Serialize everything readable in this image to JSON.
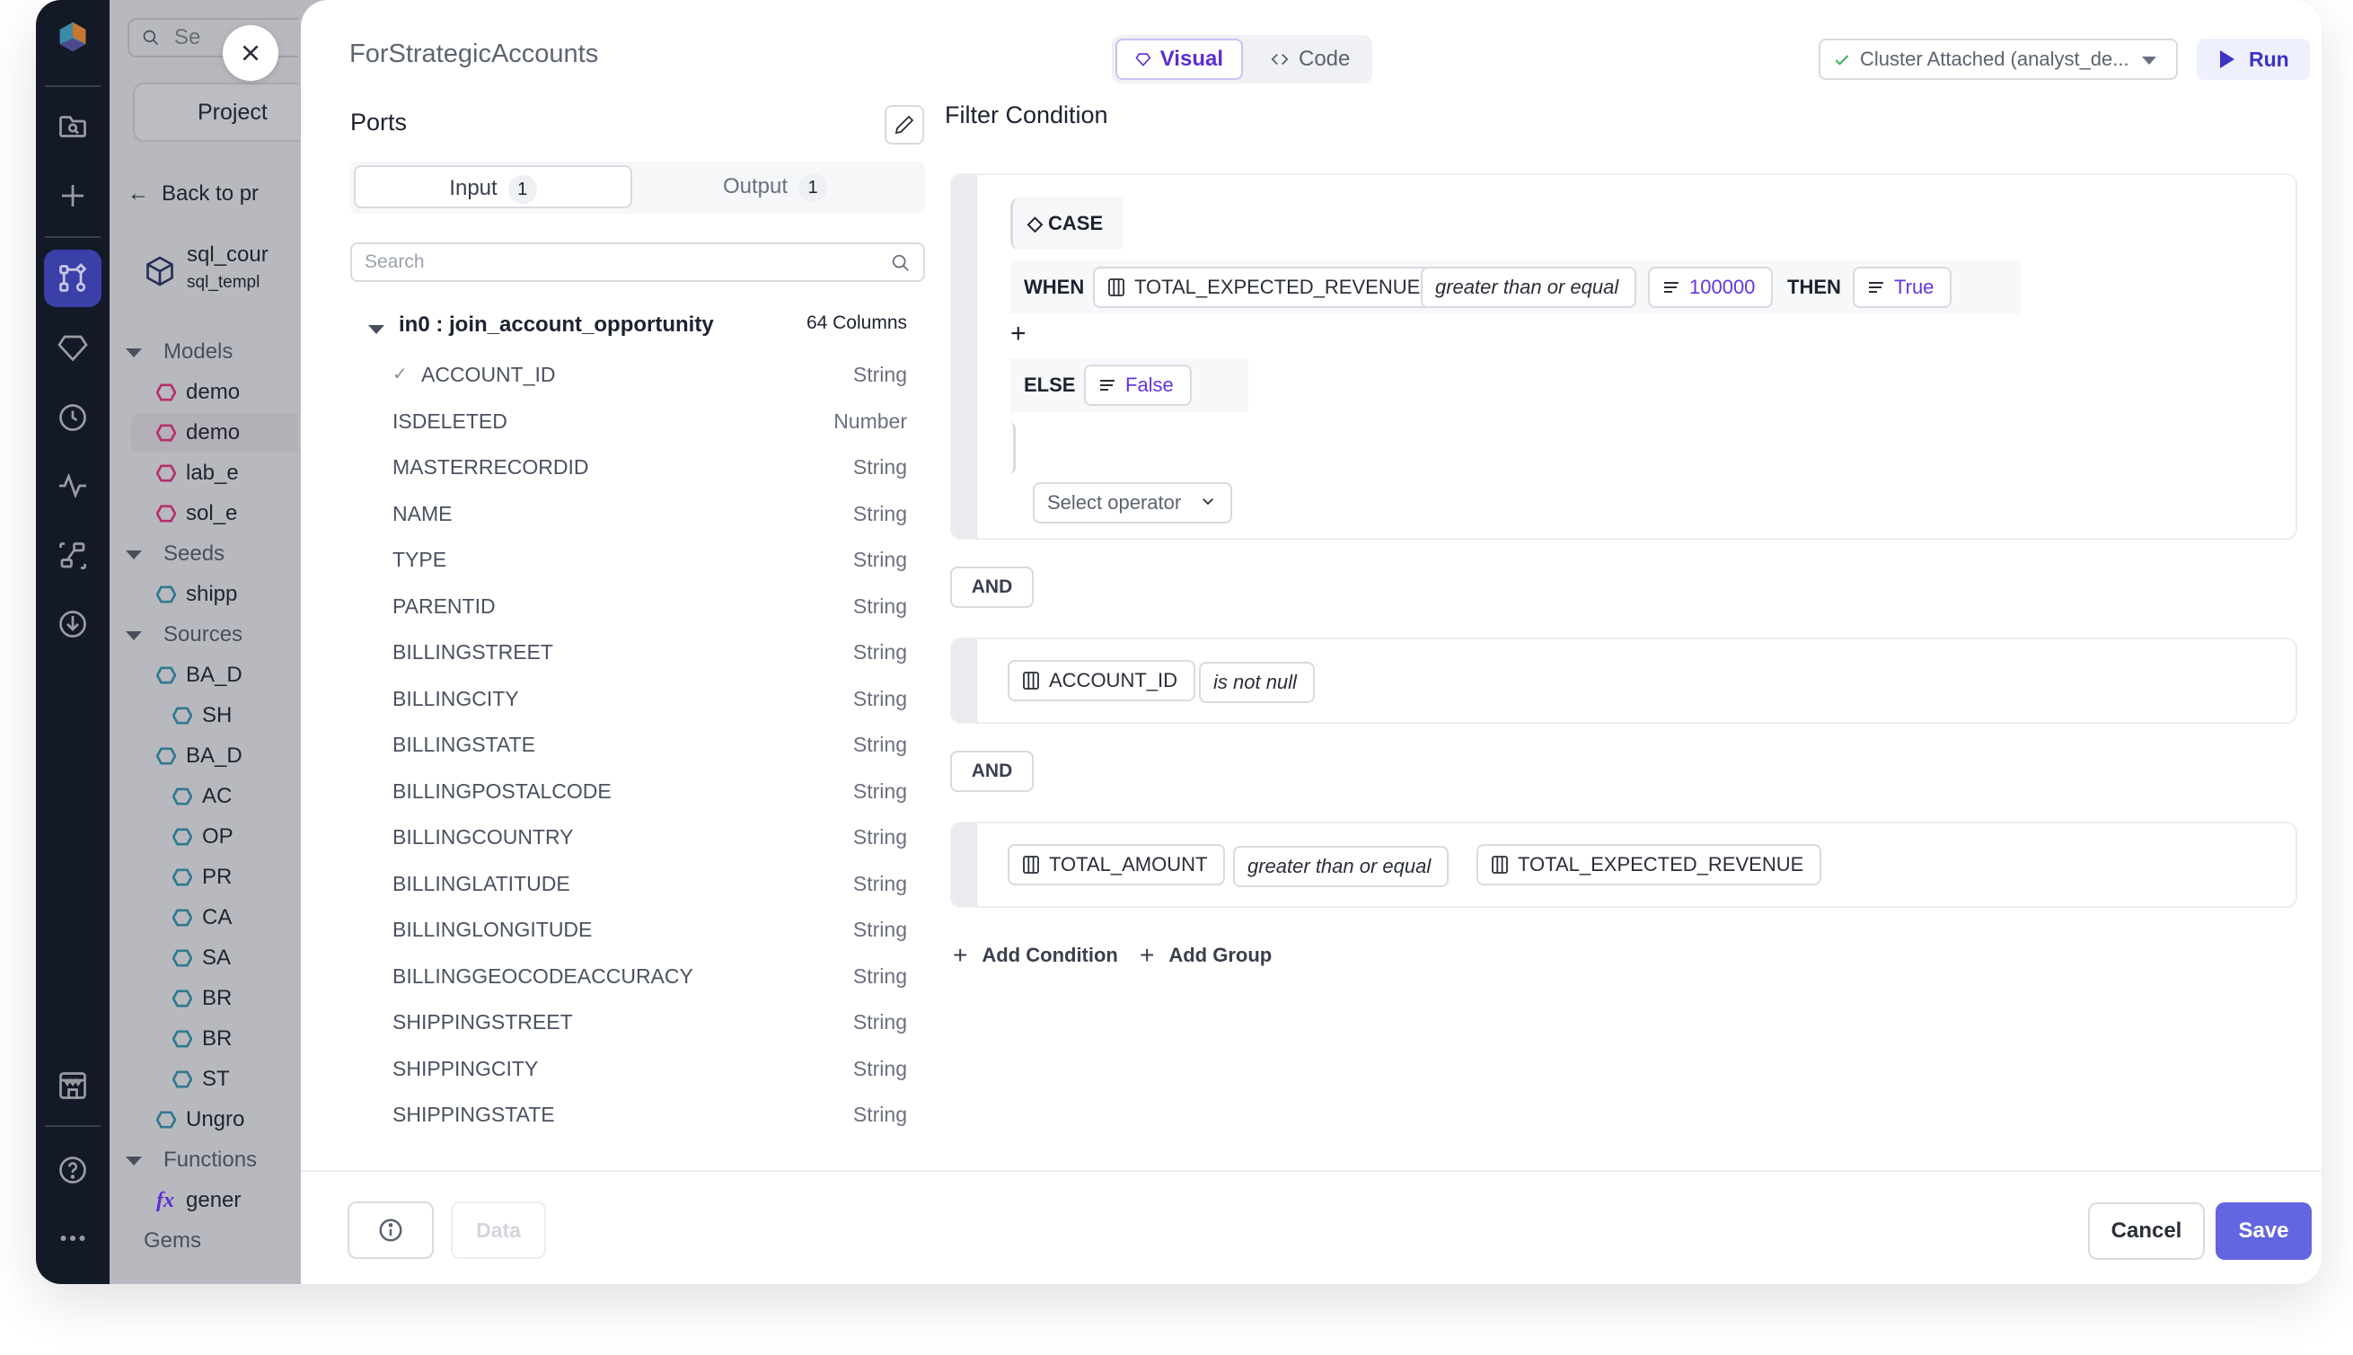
{
  "sidebar": {
    "search_placeholder": "Se",
    "project_tab": "Project",
    "back_label": "Back to pr",
    "repo_name": "sql_cour",
    "repo_template": "sql_templ",
    "tree": [
      {
        "type": "section",
        "label": "Models"
      },
      {
        "type": "model",
        "label": "demo"
      },
      {
        "type": "model",
        "label": "demo",
        "highlighted": true
      },
      {
        "type": "model",
        "label": "lab_e"
      },
      {
        "type": "model",
        "label": "sol_e"
      },
      {
        "type": "section",
        "label": "Seeds"
      },
      {
        "type": "seed",
        "label": "shipp"
      },
      {
        "type": "section",
        "label": "Sources"
      },
      {
        "type": "source",
        "label": "BA_D"
      },
      {
        "type": "source-child",
        "label": "SH"
      },
      {
        "type": "source",
        "label": "BA_D"
      },
      {
        "type": "source-child",
        "label": "AC"
      },
      {
        "type": "source-child",
        "label": "OP"
      },
      {
        "type": "source-child",
        "label": "PR"
      },
      {
        "type": "source-child",
        "label": "CA"
      },
      {
        "type": "source-child",
        "label": "SA"
      },
      {
        "type": "source-child",
        "label": "BR"
      },
      {
        "type": "source-child",
        "label": "BR"
      },
      {
        "type": "source-child",
        "label": "ST"
      },
      {
        "type": "source",
        "label": "Ungro"
      },
      {
        "type": "section",
        "label": "Functions"
      },
      {
        "type": "function",
        "label": "gener"
      },
      {
        "type": "plain",
        "label": "Gems"
      }
    ]
  },
  "modal": {
    "title": "ForStrategicAccounts",
    "view_toggle": {
      "visual": "Visual",
      "code": "Code",
      "active": "visual"
    },
    "cluster": {
      "label": "Cluster Attached (analyst_de...",
      "status": "attached"
    },
    "run_label": "Run",
    "ports": {
      "heading": "Ports",
      "tabs": [
        {
          "label": "Input",
          "count": "1"
        },
        {
          "label": "Output",
          "count": "1"
        }
      ],
      "search_placeholder": "Search",
      "port_name": "in0 : join_account_opportunity",
      "column_count": "64 Columns",
      "columns": [
        {
          "name": "ACCOUNT_ID",
          "type": "String",
          "selected": true
        },
        {
          "name": "ISDELETED",
          "type": "Number"
        },
        {
          "name": "MASTERRECORDID",
          "type": "String"
        },
        {
          "name": "NAME",
          "type": "String"
        },
        {
          "name": "TYPE",
          "type": "String"
        },
        {
          "name": "PARENTID",
          "type": "String"
        },
        {
          "name": "BILLINGSTREET",
          "type": "String"
        },
        {
          "name": "BILLINGCITY",
          "type": "String"
        },
        {
          "name": "BILLINGSTATE",
          "type": "String"
        },
        {
          "name": "BILLINGPOSTALCODE",
          "type": "String"
        },
        {
          "name": "BILLINGCOUNTRY",
          "type": "String"
        },
        {
          "name": "BILLINGLATITUDE",
          "type": "String"
        },
        {
          "name": "BILLINGLONGITUDE",
          "type": "String"
        },
        {
          "name": "BILLINGGEOCODEACCURACY",
          "type": "String"
        },
        {
          "name": "SHIPPINGSTREET",
          "type": "String"
        },
        {
          "name": "SHIPPINGCITY",
          "type": "String"
        },
        {
          "name": "SHIPPINGSTATE",
          "type": "String"
        }
      ]
    },
    "filter": {
      "heading": "Filter Condition",
      "case_block": {
        "case_label": "CASE",
        "when_label": "WHEN",
        "when_column": "TOTAL_EXPECTED_REVENUE",
        "when_operator": "greater than or equal",
        "when_value": "100000",
        "then_label": "THEN",
        "then_value": "True",
        "else_label": "ELSE",
        "else_value": "False",
        "select_operator_placeholder": "Select operator"
      },
      "and_label_1": "AND",
      "condition_2": {
        "column": "ACCOUNT_ID",
        "operator": "is not null"
      },
      "and_label_2": "AND",
      "condition_3": {
        "left_column": "TOTAL_AMOUNT",
        "operator": "greater than or equal",
        "right_column": "TOTAL_EXPECTED_REVENUE"
      },
      "add_condition": "Add Condition",
      "add_group": "Add Group"
    },
    "footer": {
      "data_label": "Data",
      "cancel_label": "Cancel",
      "save_label": "Save"
    }
  },
  "colors": {
    "accent": "#6366e0",
    "visual_active": "#5b2ed4",
    "literal": "#6435e0",
    "model_icon": "#b5306f",
    "source_icon": "#2f7a90",
    "rail_bg": "#141927"
  }
}
